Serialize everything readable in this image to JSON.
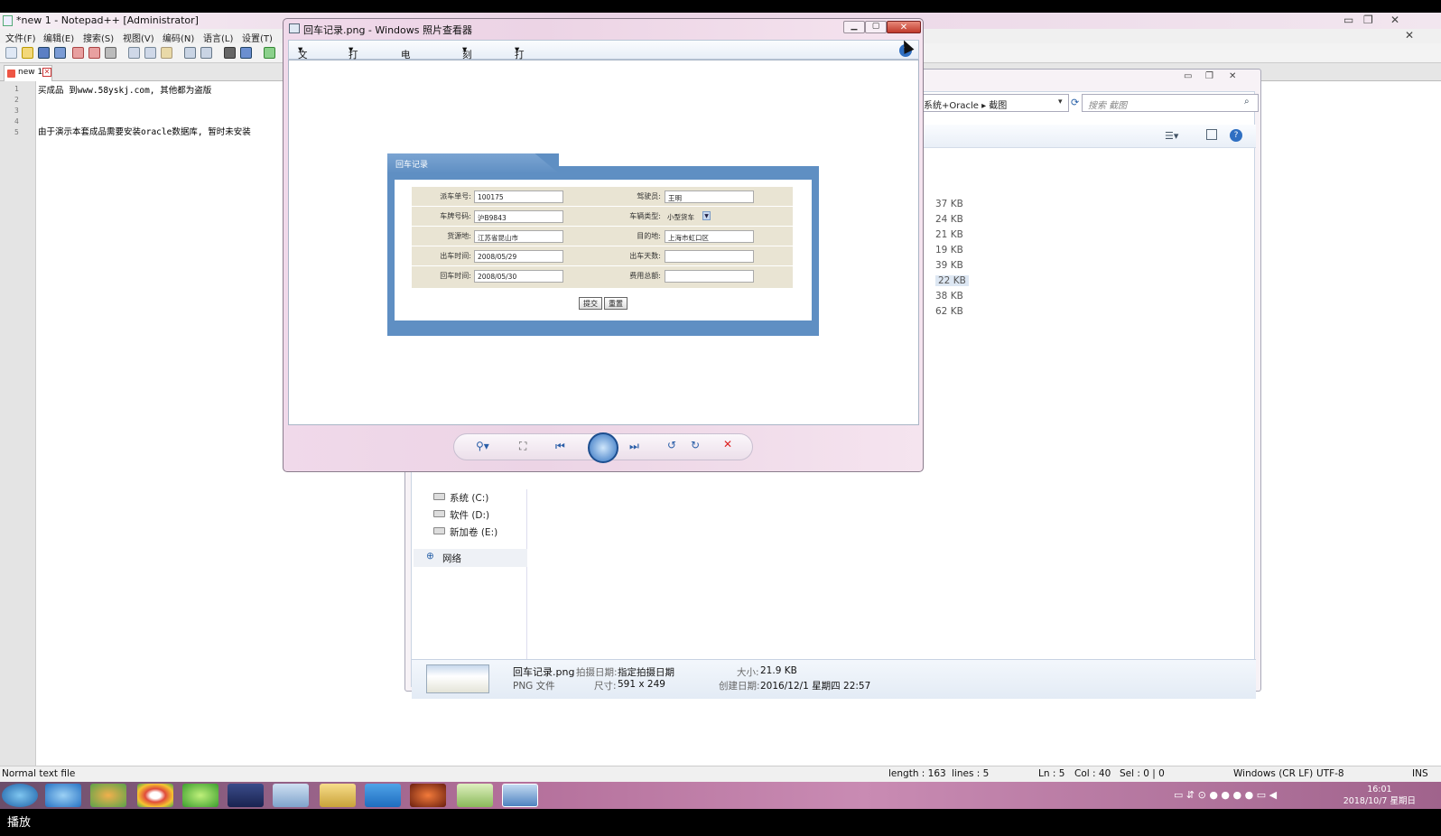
{
  "notepad": {
    "title": "*new 1 - Notepad++ [Administrator]",
    "menu": [
      "文件(F)",
      "编辑(E)",
      "搜索(S)",
      "视图(V)",
      "编码(N)",
      "语言(L)",
      "设置(T)"
    ],
    "tab_label": "new 1",
    "lines": [
      "1",
      "2",
      "3",
      "4",
      "5"
    ],
    "code_line1": "买成品    到www.58yskj.com, 其他都为盗版",
    "code_line5": "由于演示本套成品需要安装oracle数据库, 暂时未安装",
    "status": {
      "file_type": "Normal text file",
      "length": "length : 163",
      "lines": "lines : 5",
      "ln": "Ln : 5",
      "col": "Col : 40",
      "sel": "Sel : 0 | 0",
      "eol": "Windows (CR LF)",
      "encoding": "UTF-8",
      "mode": "INS"
    }
  },
  "explorer": {
    "address": "系统+Oracle ▸ 截图",
    "search_placeholder": "搜索 截图",
    "sizes": [
      "37 KB",
      "24 KB",
      "21 KB",
      "19 KB",
      "39 KB",
      "22 KB",
      "38 KB",
      "62 KB"
    ],
    "drives": [
      "系统 (C:)",
      "软件 (D:)",
      "新加卷 (E:)"
    ],
    "network": "网络",
    "details": {
      "filename": "回车记录.png",
      "filetype": "PNG 文件",
      "date_taken_label": "拍摄日期:",
      "date_taken": "指定拍摄日期",
      "dimensions_label": "尺寸:",
      "dimensions": "591 x 249",
      "size_label": "大小:",
      "size": "21.9 KB",
      "created_label": "创建日期:",
      "created": "2016/12/1 星期四 22:57"
    }
  },
  "viewer": {
    "title": "回车记录.png - Windows 照片查看器",
    "menu": [
      "文件(F)",
      "打印(P)",
      "电子邮件(E)",
      "刻录(U)",
      "打开(O)"
    ],
    "close_glyph": "✕",
    "form": {
      "title": "回车记录",
      "fields": {
        "dispatch_no_label": "派车单号:",
        "dispatch_no": "100175",
        "driver_label": "驾驶员:",
        "driver": "王明",
        "plate_label": "车牌号码:",
        "plate": "沪B9843",
        "type_label": "车辆类型:",
        "type": "小型货车",
        "source_label": "货源地:",
        "source": "江苏省昆山市",
        "dest_label": "目的地:",
        "dest": "上海市虹口区",
        "out_time_label": "出车时间:",
        "out_time": "2008/05/29",
        "out_days_label": "出车天数:",
        "out_days": "",
        "back_time_label": "回车时间:",
        "back_time": "2008/05/30",
        "fee_label": "费用总额:",
        "fee": ""
      },
      "submit": "提交",
      "reset": "重置"
    }
  },
  "taskbar": {
    "time": "16:01",
    "date": "2018/10/7 星期日"
  },
  "bottom_caption": "播放"
}
